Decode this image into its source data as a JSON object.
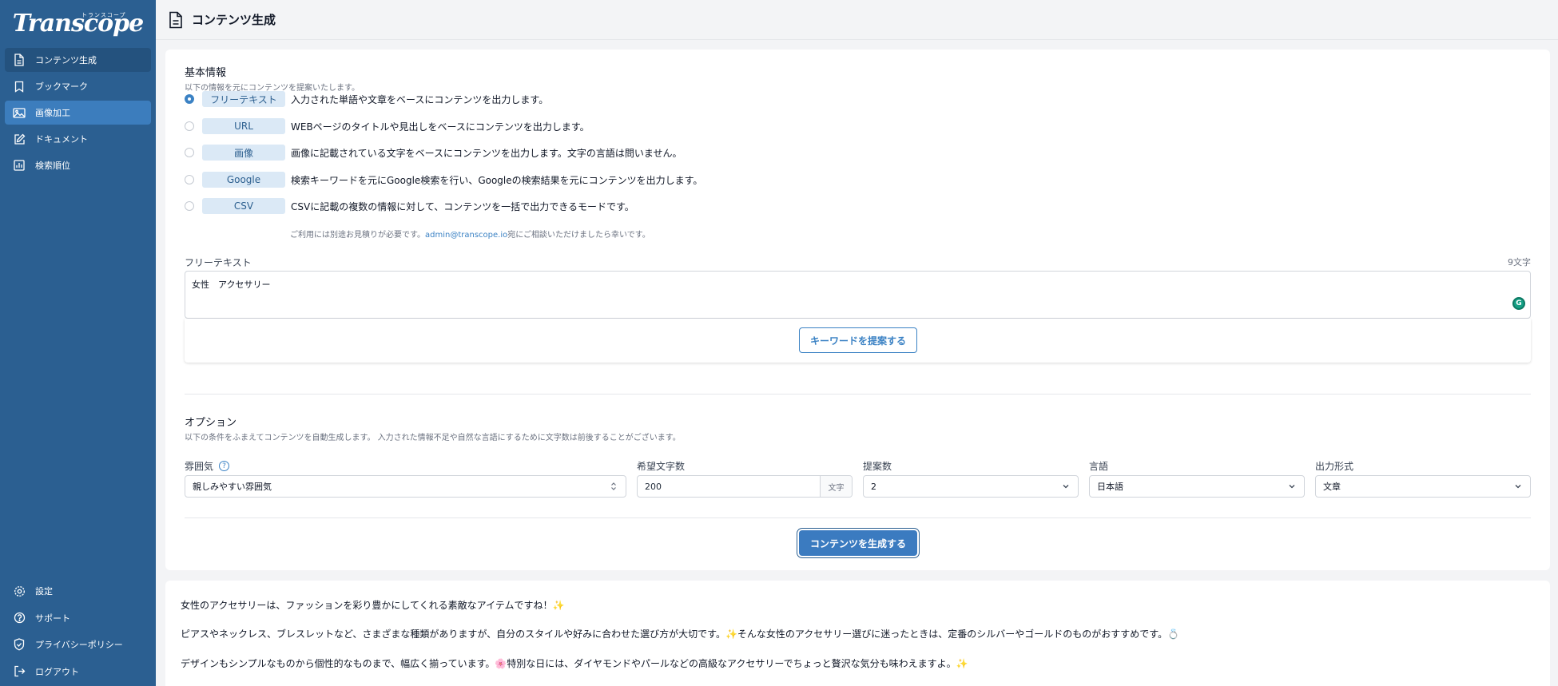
{
  "app": {
    "logo": "Transcope",
    "logo_kana": "トランスコープ"
  },
  "sidebar": {
    "items": [
      {
        "label": "コンテンツ生成",
        "icon": "document-icon"
      },
      {
        "label": "ブックマーク",
        "icon": "bookmark-icon"
      },
      {
        "label": "画像加工",
        "icon": "image-icon"
      },
      {
        "label": "ドキュメント",
        "icon": "edit-icon"
      },
      {
        "label": "検索順位",
        "icon": "chart-icon"
      }
    ],
    "bottom_items": [
      {
        "label": "設定",
        "icon": "gear-icon"
      },
      {
        "label": "サポート",
        "icon": "question-icon"
      },
      {
        "label": "プライバシーポリシー",
        "icon": "shield-icon"
      },
      {
        "label": "ログアウト",
        "icon": "logout-icon"
      }
    ]
  },
  "header": {
    "title": "コンテンツ生成"
  },
  "basic": {
    "title": "基本情報",
    "subtitle": "以下の情報を元にコンテンツを提案いたします。",
    "options": [
      {
        "chip": "フリーテキスト",
        "desc": "入力された単語や文章をベースにコンテンツを出力します。",
        "checked": true
      },
      {
        "chip": "URL",
        "desc": "WEBページのタイトルや見出しをベースにコンテンツを出力します。",
        "checked": false
      },
      {
        "chip": "画像",
        "desc": "画像に記載されている文字をベースにコンテンツを出力します。文字の言語は問いません。",
        "checked": false
      },
      {
        "chip": "Google",
        "desc": "検索キーワードを元にGoogle検索を行い、Googleの検索結果を元にコンテンツを出力します。",
        "checked": false
      },
      {
        "chip": "CSV",
        "desc": "CSVに記載の複数の情報に対して、コンテンツを一括で出力できるモードです。",
        "checked": false
      }
    ],
    "csv_note_pre": "ご利用には別途お見積りが必要です。",
    "csv_note_mail": "admin@transcope.io",
    "csv_note_post": "宛にご相談いただけましたら幸いです。",
    "free_label": "フリーテキスト",
    "char_count": "9文字",
    "free_value": "女性　アクセサリー",
    "keyword_button": "キーワードを提案する"
  },
  "options": {
    "title": "オプション",
    "subtitle": "以下の条件をふまえてコンテンツを自動生成します。 入力された情報不足や自然な言語にするために文字数は前後することがございます。",
    "mood_label": "雰囲気",
    "mood_value": "親しみやすい雰囲気",
    "length_label": "希望文字数",
    "length_value": "200",
    "length_unit": "文字",
    "count_label": "提案数",
    "count_value": "2",
    "lang_label": "言語",
    "lang_value": "日本語",
    "format_label": "出力形式",
    "format_value": "文章",
    "generate_button": "コンテンツを生成する"
  },
  "output": {
    "lines": [
      "女性のアクセサリーは、ファッションを彩り豊かにしてくれる素敵なアイテムですね！✨",
      "ピアスやネックレス、ブレスレットなど、さまざまな種類がありますが、自分のスタイルや好みに合わせた選び方が大切です。✨そんな女性のアクセサリー選びに迷ったときは、定番のシルバーやゴールドのものがおすすめです。💍",
      "デザインもシンプルなものから個性的なものまで、幅広く揃っています。🌸特別な日には、ダイヤモンドやパールなどの高級なアクセサリーでちょっと贅沢な気分も味わえますよ。✨"
    ]
  },
  "colors": {
    "sidebar": "#2b5f91",
    "accent": "#3b82c4",
    "chip_bg": "#dbe9f6"
  }
}
